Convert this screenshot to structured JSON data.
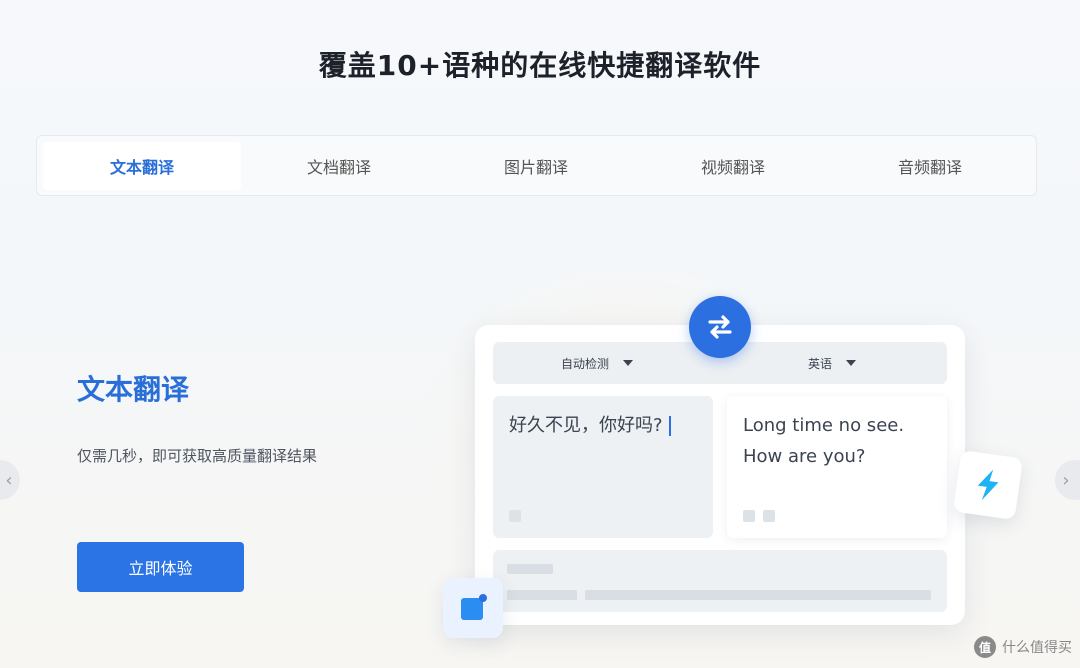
{
  "header": {
    "title": "覆盖10+语种的在线快捷翻译软件"
  },
  "tabs": [
    {
      "label": "文本翻译",
      "active": true
    },
    {
      "label": "文档翻译",
      "active": false
    },
    {
      "label": "图片翻译",
      "active": false
    },
    {
      "label": "视频翻译",
      "active": false
    },
    {
      "label": "音频翻译",
      "active": false
    }
  ],
  "feature": {
    "heading": "文本翻译",
    "description": "仅需几秒，即可获取高质量翻译结果",
    "cta_label": "立即体验"
  },
  "translator": {
    "source_lang": "自动检测",
    "target_lang": "英语",
    "source_text": "好久不见，你好吗?",
    "target_text_line1": "Long time no see.",
    "target_text_line2": "How are you?"
  },
  "watermark": {
    "text": "什么值得买",
    "logo_char": "值"
  },
  "icons": {
    "swap": "swap-arrows-icon",
    "bolt": "lightning-bolt-icon",
    "note": "note-icon",
    "prev": "chevron-left-icon",
    "next": "chevron-right-icon"
  },
  "colors": {
    "accent": "#2a6fd8",
    "button": "#2b74e6",
    "bolt": "#1fb3f5"
  }
}
